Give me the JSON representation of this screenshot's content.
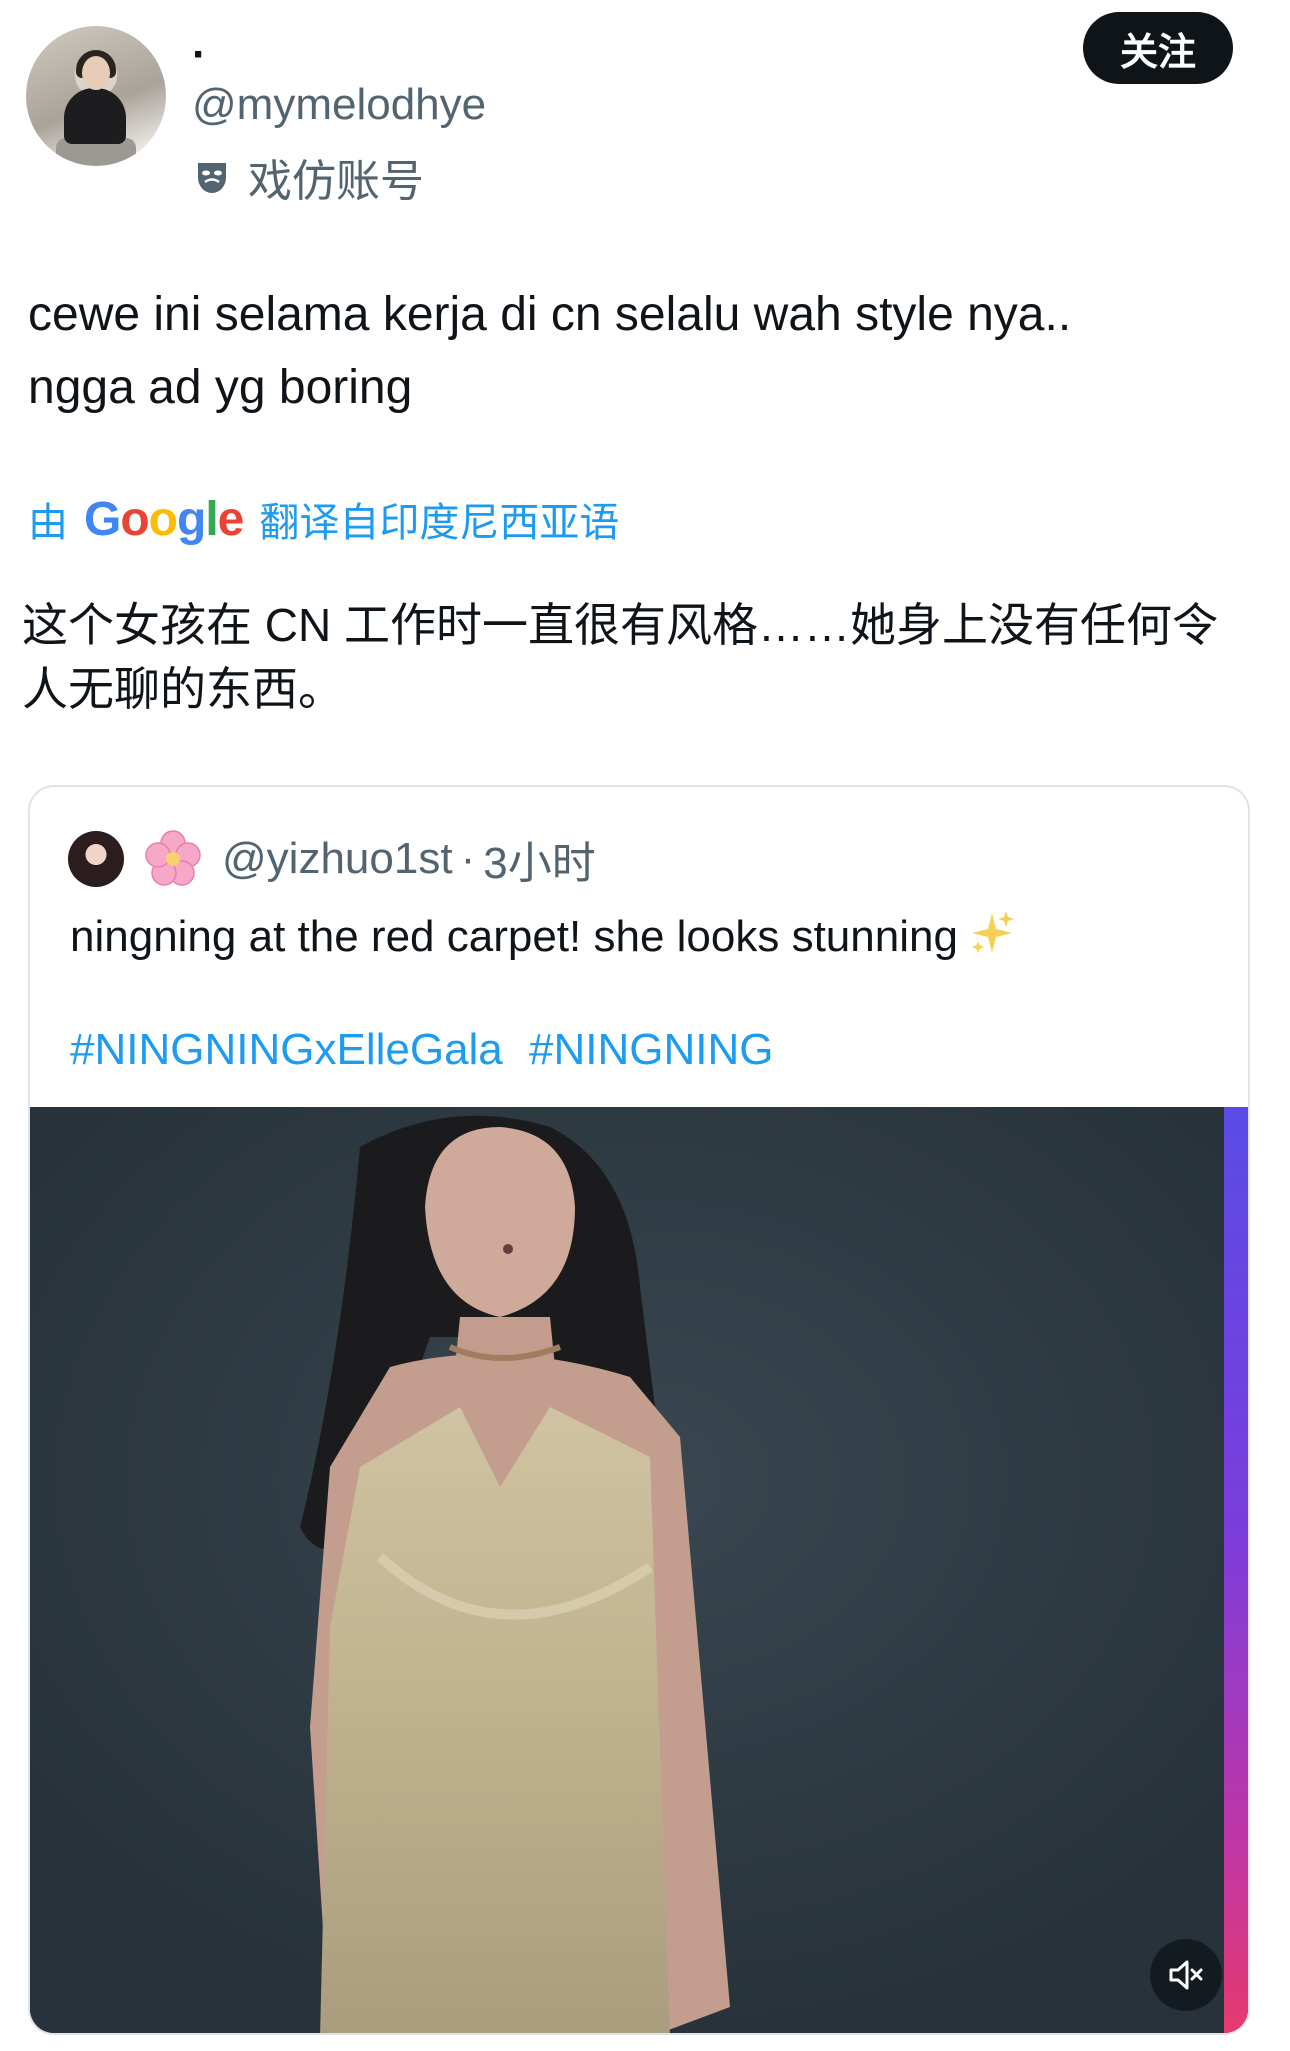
{
  "author": {
    "display_name": "·",
    "handle": "@mymelodhye",
    "parody_label": "戏仿账号"
  },
  "follow_button": "关注",
  "tweet": {
    "lines": [
      "cewe ini selama kerja di cn selalu wah style nya..",
      "ngga ad yg boring"
    ]
  },
  "translation": {
    "prefix": "由",
    "provider": "Google",
    "suffix": "翻译自印度尼西亚语",
    "lines": [
      "这个女孩在 CN 工作时一直很有风格……她身上没有任何令",
      "人无聊的东西。"
    ]
  },
  "quoted_tweet": {
    "handle": "@yizhuo1st",
    "separator": "·",
    "time": "3小时",
    "text": "ningning at the red carpet! she looks stunning",
    "hashtags": [
      "#NINGNINGxElleGala",
      "#NINGNING"
    ]
  },
  "icons": {
    "parody": "theater-mask-icon",
    "flower": "cherry-blossom-icon",
    "sparkles": "sparkles-icon",
    "mute": "speaker-muted-icon"
  },
  "colors": {
    "link_blue": "#1d9bf0",
    "secondary_text": "#536471",
    "follow_bg": "#0f1419"
  }
}
